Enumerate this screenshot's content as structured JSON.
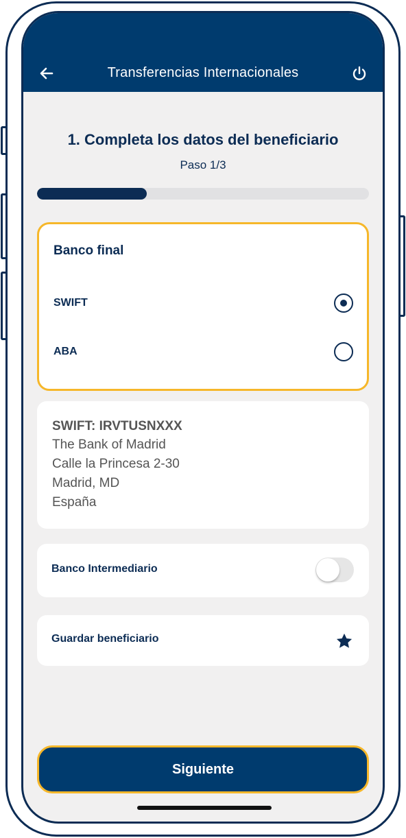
{
  "header": {
    "title": "Transferencias Internacionales",
    "back_icon": "arrow-left-icon",
    "power_icon": "power-icon"
  },
  "step": {
    "title": "1. Completa los datos del beneficiario",
    "subtitle": "Paso 1/3",
    "progress": 0.33
  },
  "bank_card": {
    "title": "Banco final",
    "options": [
      {
        "label": "SWIFT",
        "selected": true
      },
      {
        "label": "ABA",
        "selected": false
      }
    ]
  },
  "bank_info": {
    "swift": "SWIFT: IRVTUSNXXX",
    "lines": [
      "The Bank of Madrid",
      "Calle la Princesa 2-30",
      "Madrid, MD",
      "España"
    ]
  },
  "intermediario": {
    "label": "Banco Intermediario",
    "toggle_on": false
  },
  "guardar": {
    "label": "Guardar beneficiario",
    "icon": "star-icon"
  },
  "footer": {
    "next_label": "Siguiente"
  },
  "colors": {
    "primary": "#003b6e",
    "highlight": "#f6b72a",
    "background": "#f1f0f0"
  }
}
